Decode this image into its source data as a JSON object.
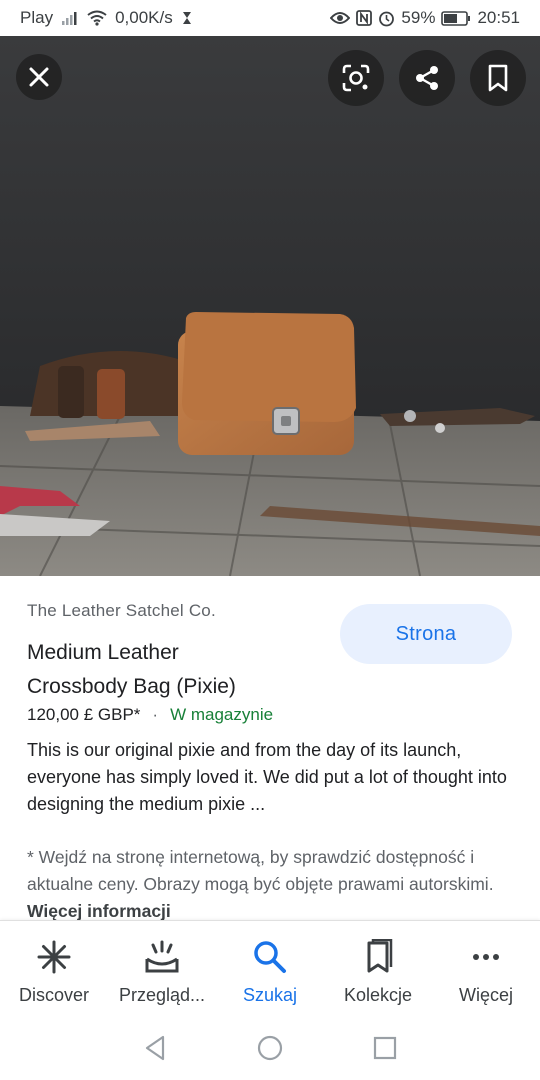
{
  "status_bar": {
    "carrier": "Play",
    "speed": "0,00K/s",
    "battery": "59%",
    "time": "20:51"
  },
  "image_toolbar": {
    "close_icon": "close-icon",
    "lens_icon": "lens-icon",
    "share_icon": "share-icon",
    "bookmark_icon": "bookmark-icon"
  },
  "result": {
    "source": "The Leather Satchel Co.",
    "title_line1": "Medium Leather",
    "title_line2": "Crossbody Bag (Pixie)",
    "price": "120,00 £ GBP*",
    "separator": "·",
    "availability": "W magazynie",
    "visit_label": "Strona",
    "description": "This is our original pixie and from the day of its launch, everyone has simply loved it. We did put a lot of thought into designing the medium pixie ...",
    "disclaimer": "* Wejdź na stronę internetową, by sprawdzić dostępność i aktualne ceny. Obrazy mogą być objęte prawami autorskimi.",
    "more_info": "Więcej informacji"
  },
  "bottom_nav": {
    "items": [
      {
        "label": "Discover",
        "icon": "asterisk-icon"
      },
      {
        "label": "Przegląd...",
        "icon": "updates-icon"
      },
      {
        "label": "Szukaj",
        "icon": "search-icon"
      },
      {
        "label": "Kolekcje",
        "icon": "collections-icon"
      },
      {
        "label": "Więcej",
        "icon": "more-icon"
      }
    ],
    "active_index": 2
  },
  "colors": {
    "accent": "#1a73e8",
    "in_stock": "#188038",
    "button_bg": "#e8f0fe"
  }
}
